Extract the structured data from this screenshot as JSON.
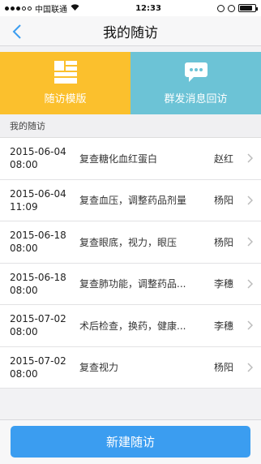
{
  "status_bar": {
    "carrier": "中国联通",
    "time": "12:33"
  },
  "nav": {
    "title": "我的随访",
    "back_icon": "chevron-left-icon"
  },
  "tiles": [
    {
      "label": "随访模版",
      "icon": "template-grid-icon",
      "color": "#fbc02d"
    },
    {
      "label": "群发消息回访",
      "icon": "chat-bubble-icon",
      "color": "#6cc3d6"
    }
  ],
  "section": {
    "title": "我的随访"
  },
  "followups": [
    {
      "date": "2015-06-04",
      "time": "08:00",
      "task": "复查糖化血红蛋白",
      "doctor": "赵红"
    },
    {
      "date": "2015-06-04",
      "time": "11:09",
      "task": "复查血压，调整药品剂量",
      "doctor": "杨阳"
    },
    {
      "date": "2015-06-18",
      "time": "08:00",
      "task": "复查眼底，视力，眼压",
      "doctor": "杨阳"
    },
    {
      "date": "2015-06-18",
      "time": "08:00",
      "task": "复查肺功能，调整药品...",
      "doctor": "李穗"
    },
    {
      "date": "2015-07-02",
      "time": "08:00",
      "task": "术后检查，换药，健康...",
      "doctor": "李穗"
    },
    {
      "date": "2015-07-02",
      "time": "08:00",
      "task": "复查视力",
      "doctor": "杨阳"
    }
  ],
  "actions": {
    "new_followup": "新建随访"
  },
  "colors": {
    "accent": "#3b9df0",
    "template_tile": "#fbc02d",
    "broadcast_tile": "#6cc3d6"
  }
}
